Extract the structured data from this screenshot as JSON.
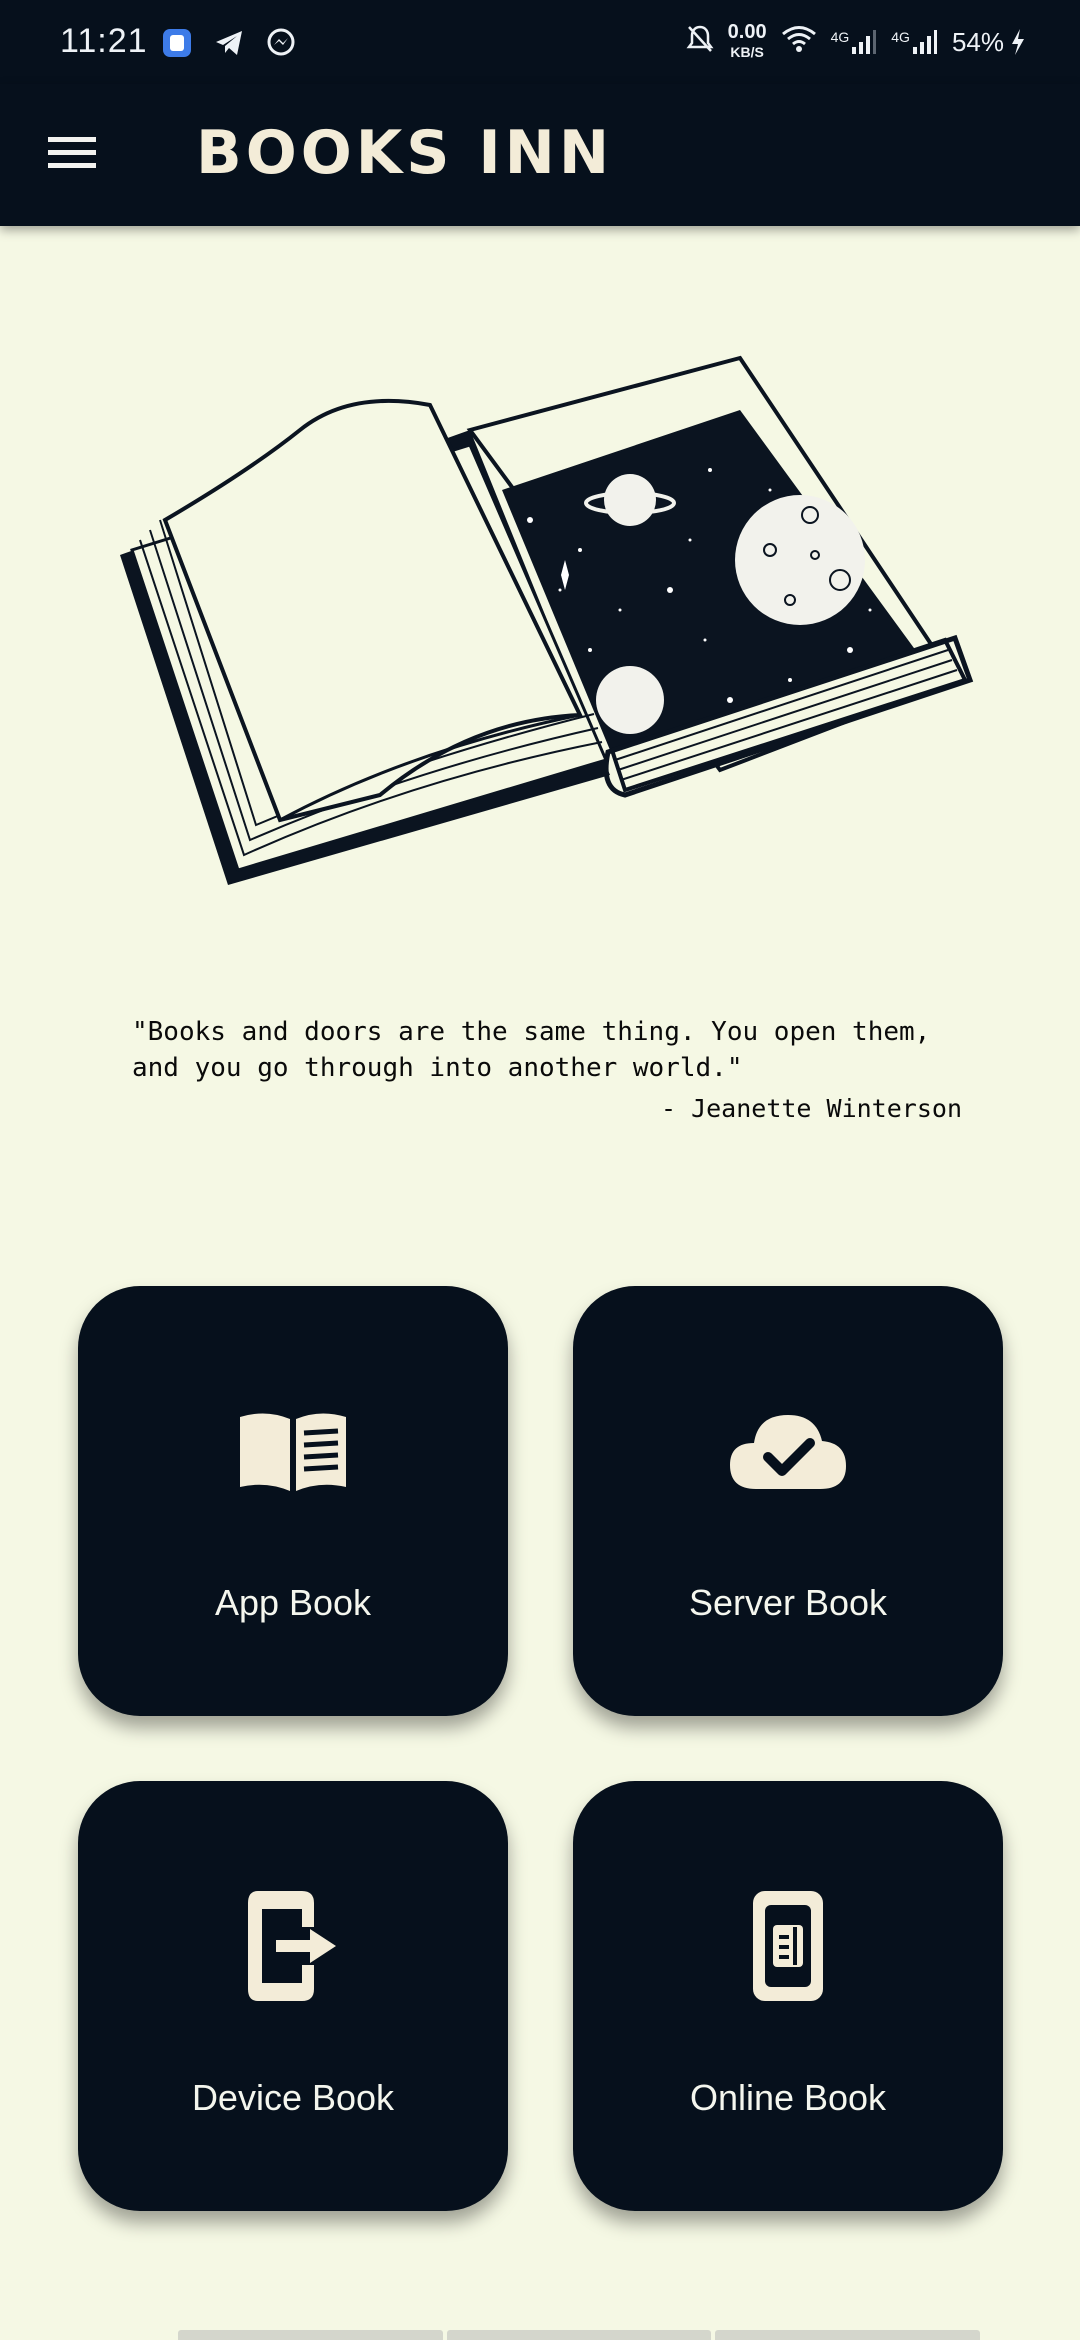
{
  "status_bar": {
    "time": "11:21",
    "net_speed_value": "0.00",
    "net_speed_unit": "KB/S",
    "net_type_1": "4G",
    "net_type_2": "4G",
    "battery": "54%"
  },
  "app_bar": {
    "title": "BOOKS INN"
  },
  "quote": {
    "text": "\"Books and doors are the same thing. You open them, and you go through into another world.\"",
    "author": "- Jeanette Winterson"
  },
  "tiles": [
    {
      "label": "App Book",
      "icon": "open-book-icon"
    },
    {
      "label": "Server Book",
      "icon": "cloud-check-icon"
    },
    {
      "label": "Device Book",
      "icon": "phone-export-icon"
    },
    {
      "label": "Online Book",
      "icon": "phone-book-icon"
    }
  ],
  "colors": {
    "background": "#f5f8e4",
    "dark": "#06101c",
    "accent_cream": "#f3ecd8"
  }
}
